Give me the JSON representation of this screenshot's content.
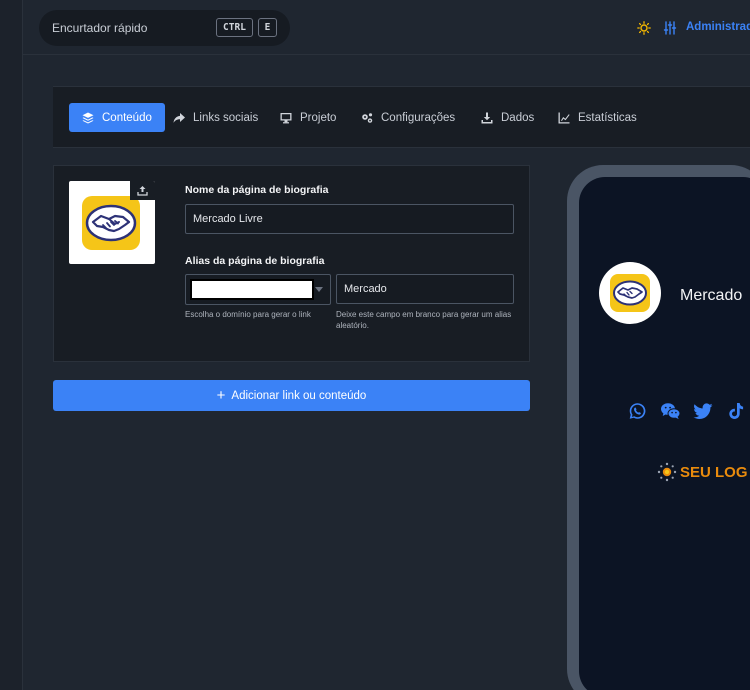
{
  "topbar": {
    "quick_shortener": "Encurtador rápido",
    "shortcut_ctrl": "CTRL",
    "shortcut_e": "E",
    "admin_label": "Administrad"
  },
  "tabs": [
    {
      "label": "Conteúdo",
      "icon": "layers-icon",
      "active": true
    },
    {
      "label": "Links sociais",
      "icon": "share-icon"
    },
    {
      "label": "Projeto",
      "icon": "monitor-icon"
    },
    {
      "label": "Configurações",
      "icon": "gears-icon"
    },
    {
      "label": "Dados",
      "icon": "download-icon"
    },
    {
      "label": "Estatísticas",
      "icon": "chart-icon"
    }
  ],
  "form": {
    "name_label": "Nome da página de biografia",
    "name_value": "Mercado Livre",
    "alias_label": "Alias da página de biografia",
    "alias_value": "Mercado",
    "domain_help": "Escolha o domínio para gerar o link",
    "alias_help": "Deixe este campo em branco para gerar um alias aleatório."
  },
  "add_button": "Adicionar link ou conteúdo",
  "preview": {
    "name": "Mercado",
    "brand_text": "SEU LOG",
    "social_icons": [
      "whatsapp-icon",
      "wechat-icon",
      "twitter-icon",
      "tiktok-icon"
    ]
  },
  "colors": {
    "accent": "#3b82f6",
    "brand_orange": "#e98b0d",
    "logo_yellow": "#f5c518"
  }
}
